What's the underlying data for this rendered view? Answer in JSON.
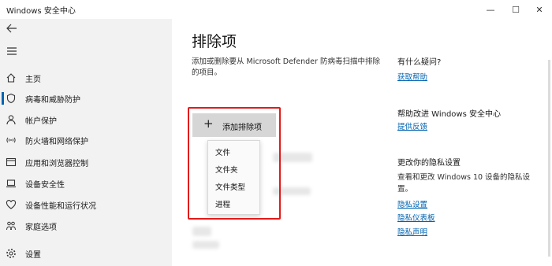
{
  "window": {
    "title": "Windows 安全中心"
  },
  "controls": {
    "minimize": "—",
    "maximize": "☐",
    "close": "✕"
  },
  "sidebar": {
    "items": [
      {
        "label": "主页",
        "icon": "home-icon"
      },
      {
        "label": "病毒和威胁防护",
        "icon": "shield-icon"
      },
      {
        "label": "帐户保护",
        "icon": "person-icon"
      },
      {
        "label": "防火墙和网络保护",
        "icon": "wifi-icon"
      },
      {
        "label": "应用和浏览器控制",
        "icon": "app-window-icon"
      },
      {
        "label": "设备安全性",
        "icon": "laptop-icon"
      },
      {
        "label": "设备性能和运行状况",
        "icon": "heart-icon"
      },
      {
        "label": "家庭选项",
        "icon": "family-icon"
      },
      {
        "label": "设置",
        "icon": "gear-icon"
      }
    ]
  },
  "main": {
    "title": "排除项",
    "description": "添加或删除要从 Microsoft Defender 防病毒扫描中排除的项目。",
    "add_button": "添加排除项",
    "menu": [
      "文件",
      "文件夹",
      "文件类型",
      "进程"
    ]
  },
  "right": {
    "help_heading": "有什么疑问?",
    "help_link": "获取帮助",
    "improve_heading": "帮助改进 Windows 安全中心",
    "feedback_link": "提供反馈",
    "privacy_heading": "更改你的隐私设置",
    "privacy_text": "查看和更改 Windows 10 设备的隐私设置。",
    "privacy_links": [
      "隐私设置",
      "隐私仪表板",
      "隐私声明"
    ]
  },
  "colors": {
    "accent": "#0063b1",
    "highlight_box": "#e21a1a",
    "sidebar_bg": "#f2f2f2"
  }
}
